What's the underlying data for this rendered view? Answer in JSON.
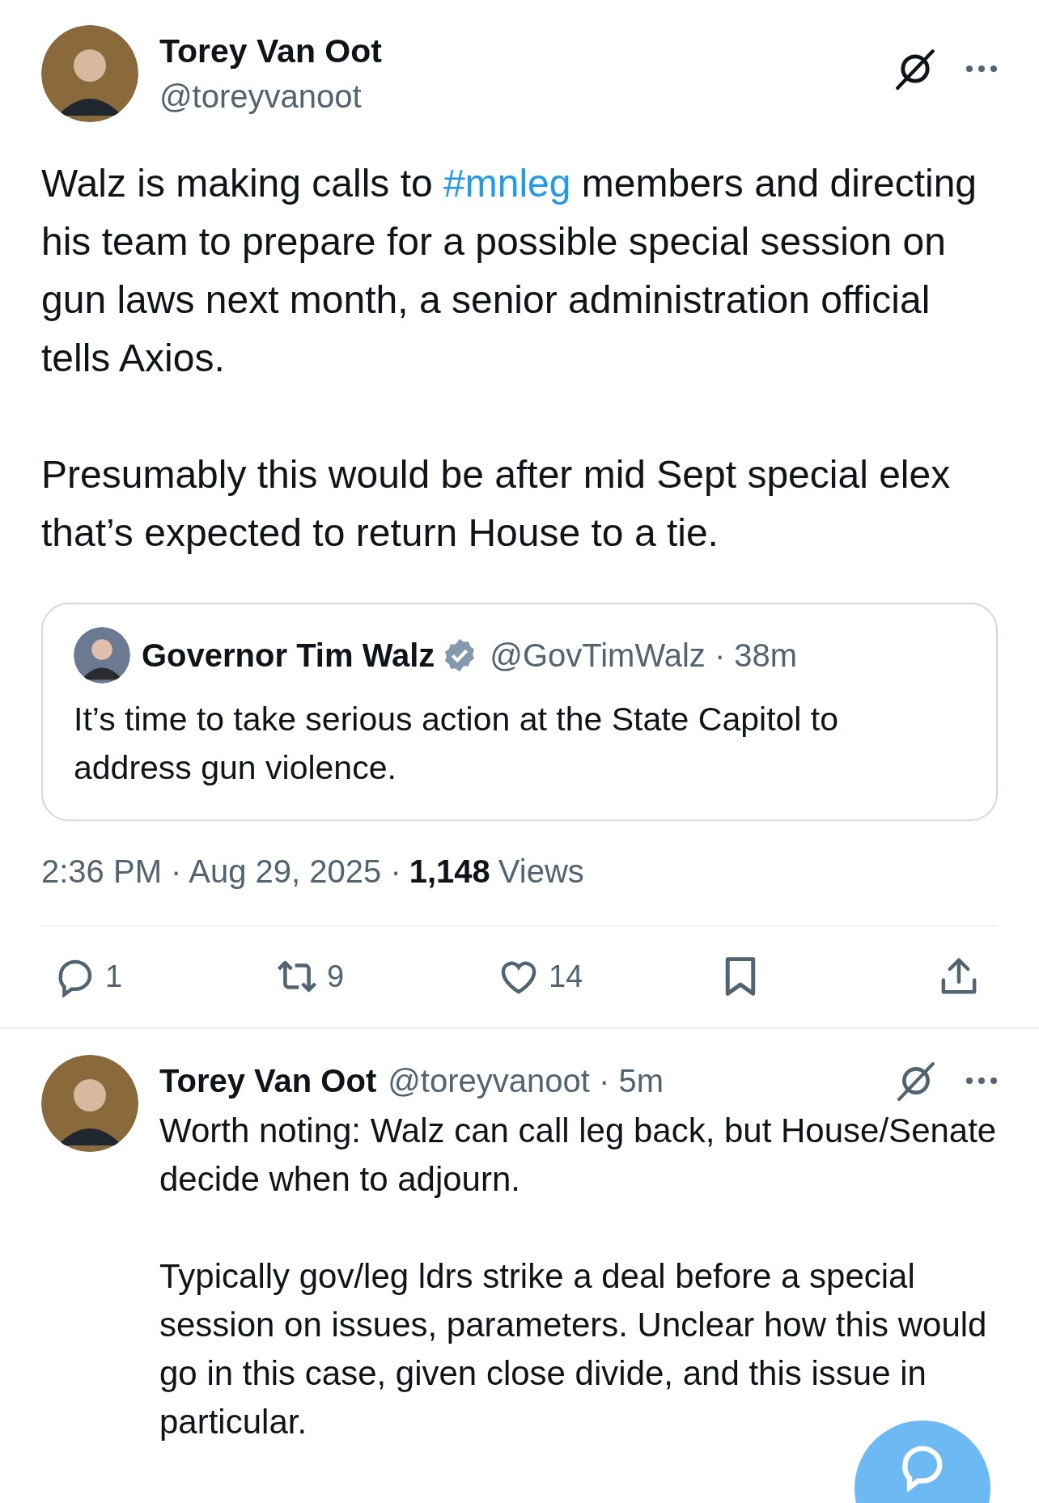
{
  "post": {
    "author": {
      "name": "Torey Van Oot",
      "handle": "@toreyvanoot"
    },
    "paragraphs": [
      [
        {
          "kind": "text",
          "text": "Walz is making calls to "
        },
        {
          "kind": "hashtag",
          "text": "#mnleg"
        },
        {
          "kind": "text",
          "text": " members and directing his team to prepare for a possible special session on gun laws next month, a senior administration official tells Axios."
        }
      ],
      [
        {
          "kind": "text",
          "text": "Presumably this would be after mid Sept special elex that’s expected to return House to a tie."
        }
      ]
    ],
    "quote": {
      "name": "Governor Tim Walz",
      "verified": true,
      "handle_time": "@GovTimWalz · 38m",
      "text": "It’s time to take serious action at the State Capitol to address gun violence."
    },
    "meta": {
      "time_date": "2:36 PM · Aug 29, 2025 ·",
      "views_count": "1,148",
      "views_label": "Views"
    },
    "actions": [
      {
        "kind": "reply",
        "count": "1"
      },
      {
        "kind": "repost",
        "count": "9"
      },
      {
        "kind": "like",
        "count": "14"
      },
      {
        "kind": "bookmark"
      },
      {
        "kind": "share"
      }
    ]
  },
  "reply": {
    "name": "Torey Van Oot",
    "handle_time": "@toreyvanoot · 5m",
    "paragraphs": [
      "Worth noting: Walz can call leg back, but House/Senate decide when to adjourn.",
      "Typically gov/leg ldrs strike a deal before a special session on issues, parameters. Unclear how this would go in this case, given close divide, and this issue in particular."
    ]
  }
}
